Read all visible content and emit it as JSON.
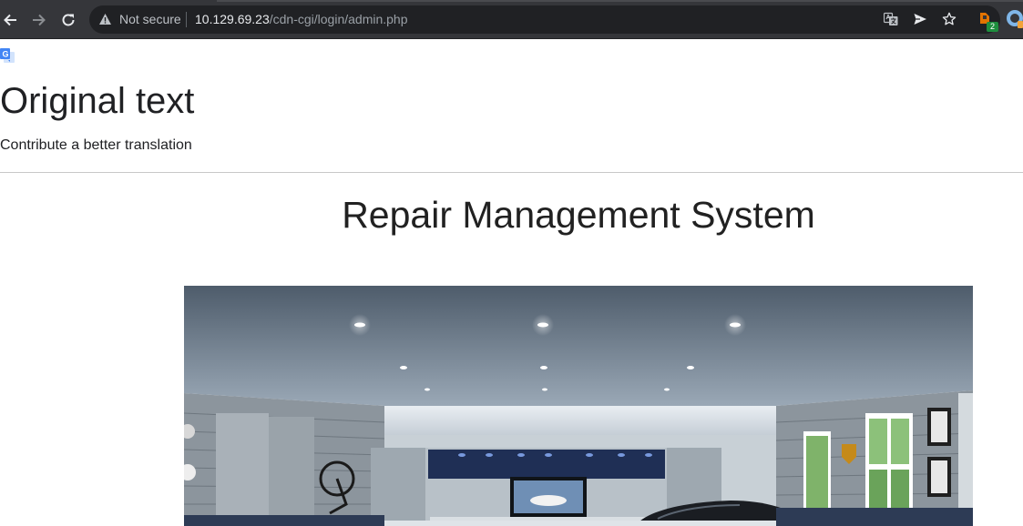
{
  "browser": {
    "security_label": "Not secure",
    "url_host": "10.129.69.23",
    "url_path": "/cdn-cgi/login/admin.php",
    "extension_badge": "2",
    "icons": [
      "back-arrow-icon",
      "forward-arrow-icon",
      "reload-icon",
      "warning-icon",
      "translate-icon",
      "send-icon",
      "star-icon",
      "extension-icon",
      "extension-icon-2"
    ]
  },
  "translate_bar": {
    "heading": "Original text",
    "contribute_link": "Contribute a better translation"
  },
  "page": {
    "title": "Repair Management System",
    "image_alt": "garage-image"
  },
  "colors": {
    "toolbar": "#35363a",
    "omnibox": "#202124",
    "accent_orange": "#e37400",
    "badge_green": "#1e8e3e"
  }
}
